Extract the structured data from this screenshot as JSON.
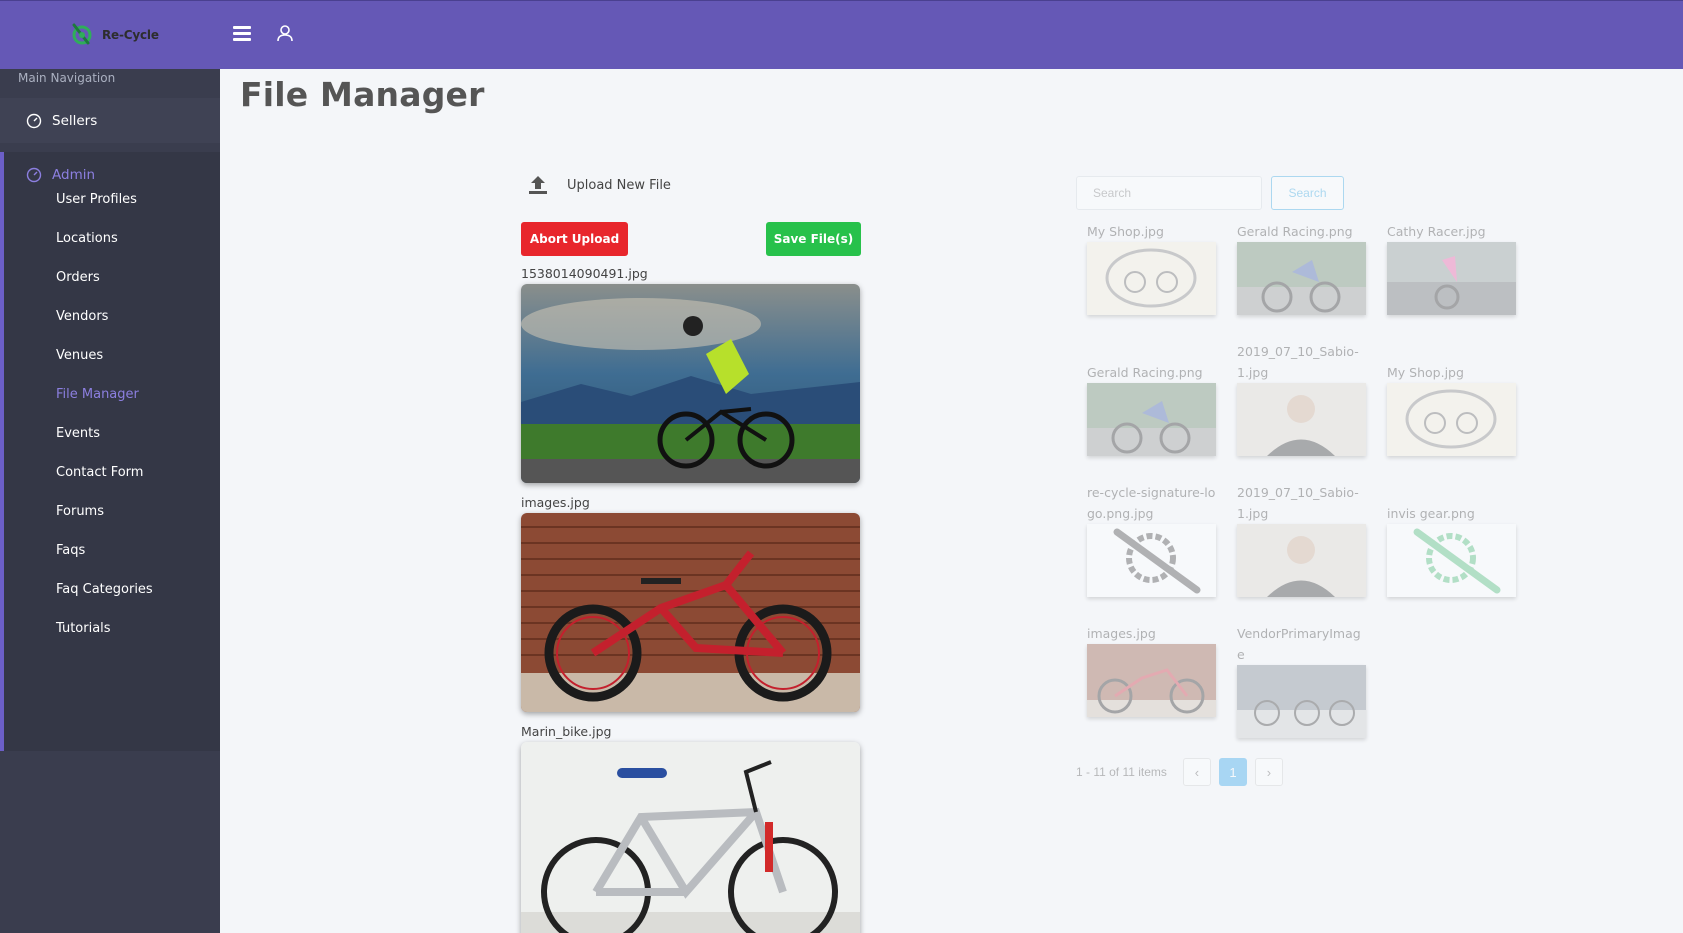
{
  "app": {
    "logo_text": "Re-Cycle"
  },
  "header": {
    "menu_icon": "hamburger-icon",
    "user_icon": "user-icon",
    "bg_color": "#6558b6"
  },
  "sidebar": {
    "caption": "Main Navigation",
    "sellers": {
      "label": "Sellers",
      "icon": "dashboard-icon"
    },
    "admin": {
      "label": "Admin",
      "icon": "dashboard-icon"
    },
    "admin_items": [
      {
        "label": "User Profiles"
      },
      {
        "label": "Locations"
      },
      {
        "label": "Orders"
      },
      {
        "label": "Vendors"
      },
      {
        "label": "Venues"
      },
      {
        "label": "File Manager",
        "active": true
      },
      {
        "label": "Events"
      },
      {
        "label": "Contact Form"
      },
      {
        "label": "Forums"
      },
      {
        "label": "Faqs"
      },
      {
        "label": "Faq Categories"
      },
      {
        "label": "Tutorials"
      }
    ],
    "active_color": "#8c7fe0"
  },
  "main": {
    "title": "File Manager",
    "upload": {
      "label": "Upload New File",
      "abort_label": "Abort Upload",
      "save_label": "Save File(s)",
      "files": [
        {
          "name": "1538014090491.jpg",
          "image": "road-cyclist-photo"
        },
        {
          "name": "images.jpg",
          "image": "red-mountain-bike-photo"
        },
        {
          "name": "Marin_bike.jpg",
          "image": "silver-mountain-bike-photo"
        }
      ]
    },
    "library": {
      "search_placeholder": "Search",
      "search_button": "Search",
      "items": [
        {
          "name": "My Shop.jpg",
          "image": "shop-logo"
        },
        {
          "name": "Gerald Racing.png",
          "image": "cyclist-racing"
        },
        {
          "name": "Cathy Racer.jpg",
          "image": "cyclist-pink"
        },
        {
          "name": "Gerald Racing.png",
          "image": "cyclist-racing"
        },
        {
          "name": "2019_07_10_Sabio-1.jpg",
          "image": "portrait"
        },
        {
          "name": "My Shop.jpg",
          "image": "shop-logo"
        },
        {
          "name": "re-cycle-signature-logo.png.jpg",
          "image": "gear-logo-gray"
        },
        {
          "name": "2019_07_10_Sabio-1.jpg",
          "image": "portrait"
        },
        {
          "name": "invis gear.png",
          "image": "gear-logo-green"
        },
        {
          "name": "images.jpg",
          "image": "red-mountain-bike"
        },
        {
          "name": "VendorPrimaryImage",
          "image": "bike-shop"
        }
      ],
      "pager": {
        "info": "1 - 11 of 11 items",
        "prev": "‹",
        "current": "1",
        "next": "›"
      }
    }
  }
}
